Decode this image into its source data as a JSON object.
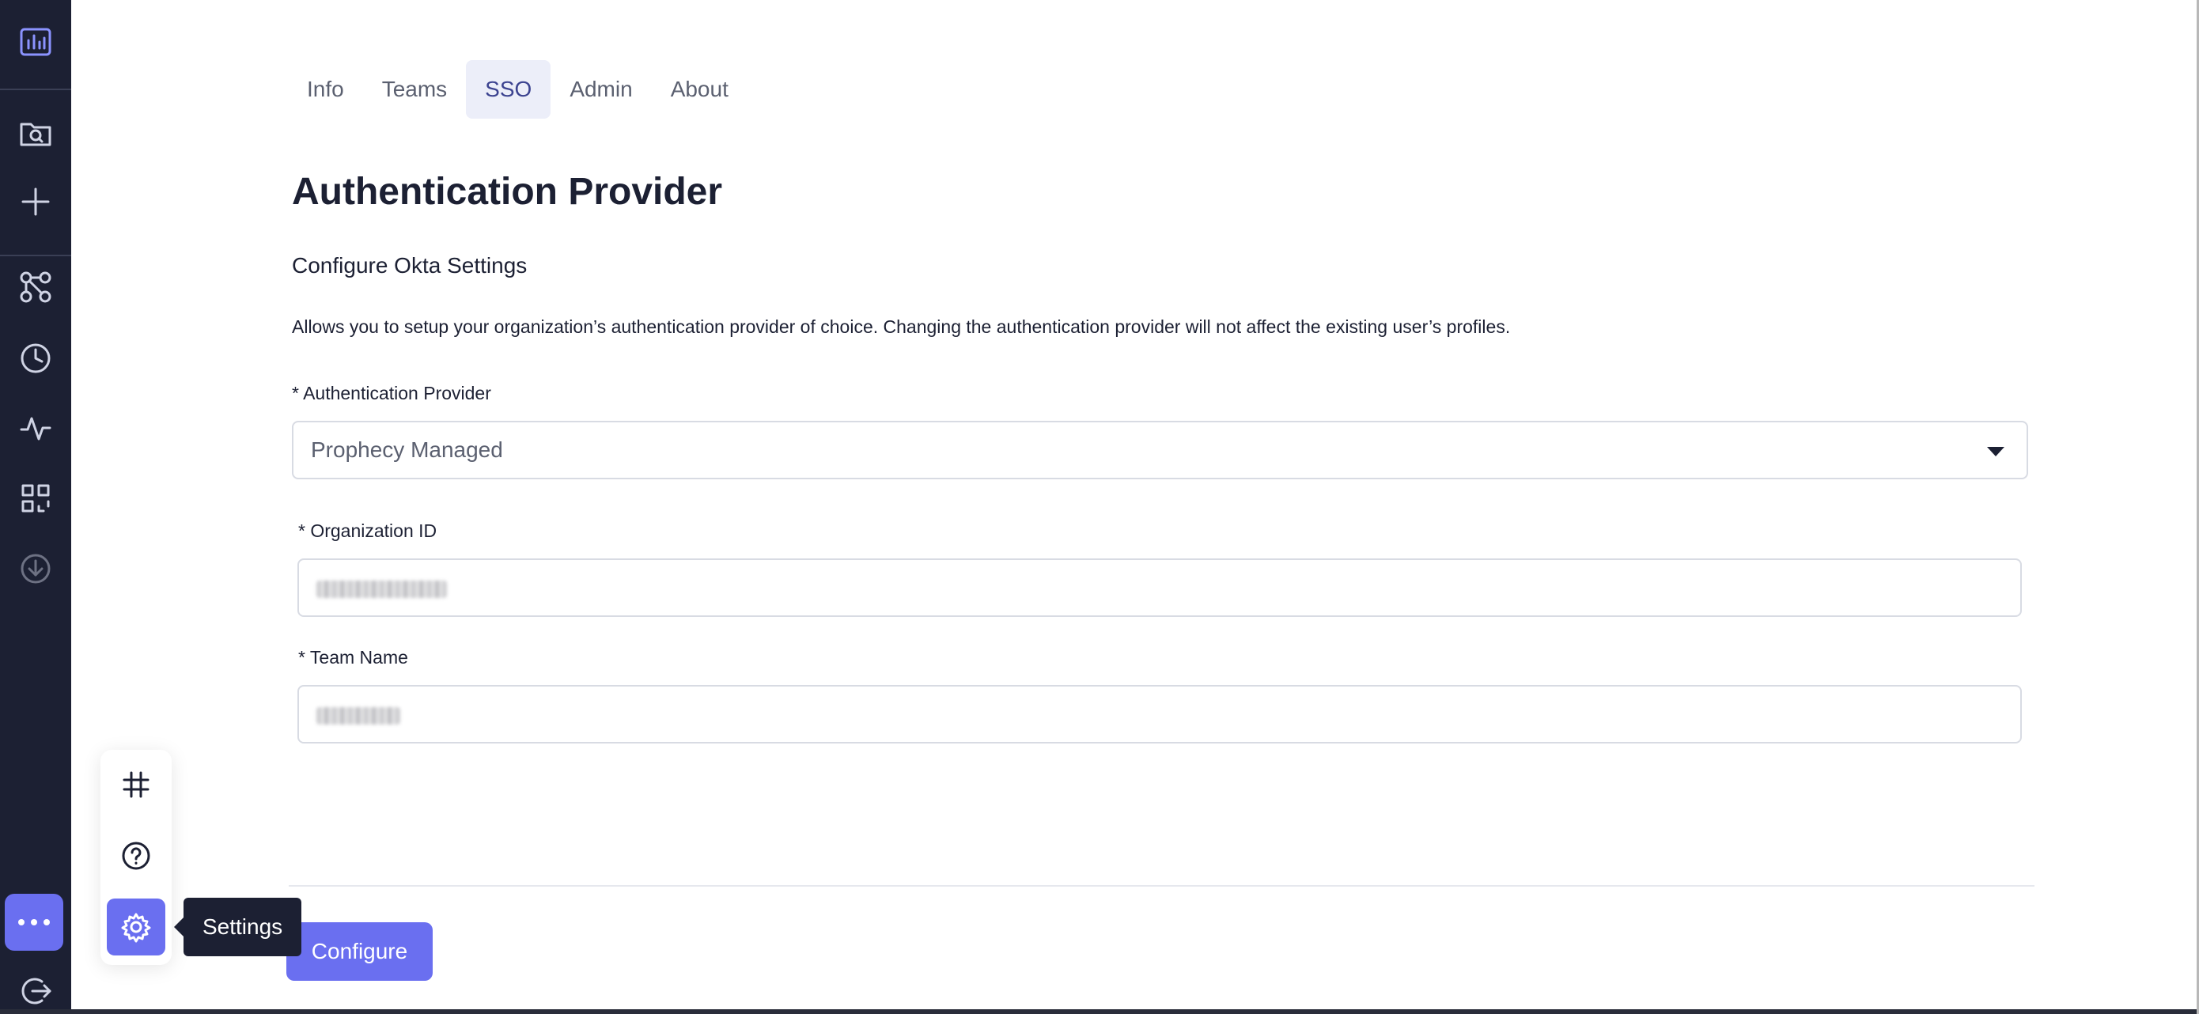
{
  "tabs": [
    {
      "label": "Info"
    },
    {
      "label": "Teams"
    },
    {
      "label": "SSO"
    },
    {
      "label": "Admin"
    },
    {
      "label": "About"
    }
  ],
  "active_tab": "SSO",
  "page": {
    "title": "Authentication Provider",
    "subtitle": "Configure Okta Settings",
    "description": "Allows you to setup your organization’s authentication provider of choice. Changing the authentication provider will not affect the existing user’s profiles."
  },
  "form": {
    "provider_label": "* Authentication Provider",
    "provider_value": "Prophecy Managed",
    "org_id_label": "* Organization ID",
    "team_name_label": "* Team Name",
    "submit_label": "Configure"
  },
  "popup": {
    "tooltip": "Settings"
  },
  "icons": {
    "sidebar": [
      "logo-icon",
      "folder-search-icon",
      "plus-icon",
      "graph-icon",
      "clock-icon",
      "activity-icon",
      "transform-icon",
      "download-icon",
      "more-icon",
      "logout-icon"
    ],
    "popup": [
      "slack-icon",
      "help-icon",
      "gear-icon"
    ]
  },
  "colors": {
    "sidebar_bg": "#1c2033",
    "accent": "#6a6ff0",
    "active_tab_bg": "#eceef9",
    "active_tab_text": "#3c4390"
  }
}
